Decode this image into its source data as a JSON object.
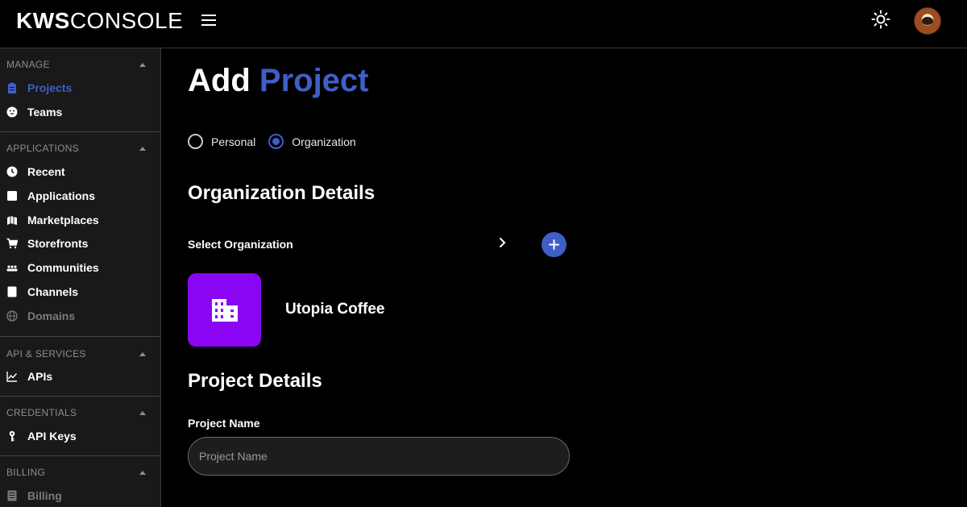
{
  "header": {
    "logo_bold": "KWS",
    "logo_light": "CONSOLE",
    "menu_icon": "hamburger-icon",
    "theme_icon": "sun-icon",
    "avatar_icon": "utopia-coffee-avatar"
  },
  "sidebar": {
    "sections": [
      {
        "title": "MANAGE",
        "items": [
          {
            "label": "Projects",
            "icon": "clipboard-icon",
            "state": "active"
          },
          {
            "label": "Teams",
            "icon": "face-icon",
            "state": "normal"
          }
        ]
      },
      {
        "title": "APPLICATIONS",
        "items": [
          {
            "label": "Recent",
            "icon": "recent-icon",
            "state": "normal"
          },
          {
            "label": "Applications",
            "icon": "app-icon",
            "state": "normal"
          },
          {
            "label": "Marketplaces",
            "icon": "marketplace-icon",
            "state": "normal"
          },
          {
            "label": "Storefronts",
            "icon": "cart-icon",
            "state": "normal"
          },
          {
            "label": "Communities",
            "icon": "people-icon",
            "state": "normal"
          },
          {
            "label": "Channels",
            "icon": "channel-icon",
            "state": "normal"
          },
          {
            "label": "Domains",
            "icon": "globe-icon",
            "state": "disabled"
          }
        ]
      },
      {
        "title": "API & SERVICES",
        "items": [
          {
            "label": "APIs",
            "icon": "chart-icon",
            "state": "normal"
          }
        ]
      },
      {
        "title": "CREDENTIALS",
        "items": [
          {
            "label": "API Keys",
            "icon": "key-icon",
            "state": "normal"
          }
        ]
      },
      {
        "title": "BILLING",
        "items": [
          {
            "label": "Billing",
            "icon": "billing-icon",
            "state": "disabled"
          }
        ]
      }
    ]
  },
  "main": {
    "title_plain": "Add",
    "title_accent": "Project",
    "radio": {
      "personal": "Personal",
      "organization": "Organization",
      "selected": "organization"
    },
    "org_details_heading": "Organization Details",
    "select_org_label": "Select Organization",
    "org_name": "Utopia Coffee",
    "project_details_heading": "Project Details",
    "project_name_label": "Project Name",
    "project_name_placeholder": "Project Name",
    "project_name_value": ""
  },
  "colors": {
    "accent": "#3f5fc7",
    "org_card": "#8a05f4",
    "sidebar_bg": "#191919"
  }
}
